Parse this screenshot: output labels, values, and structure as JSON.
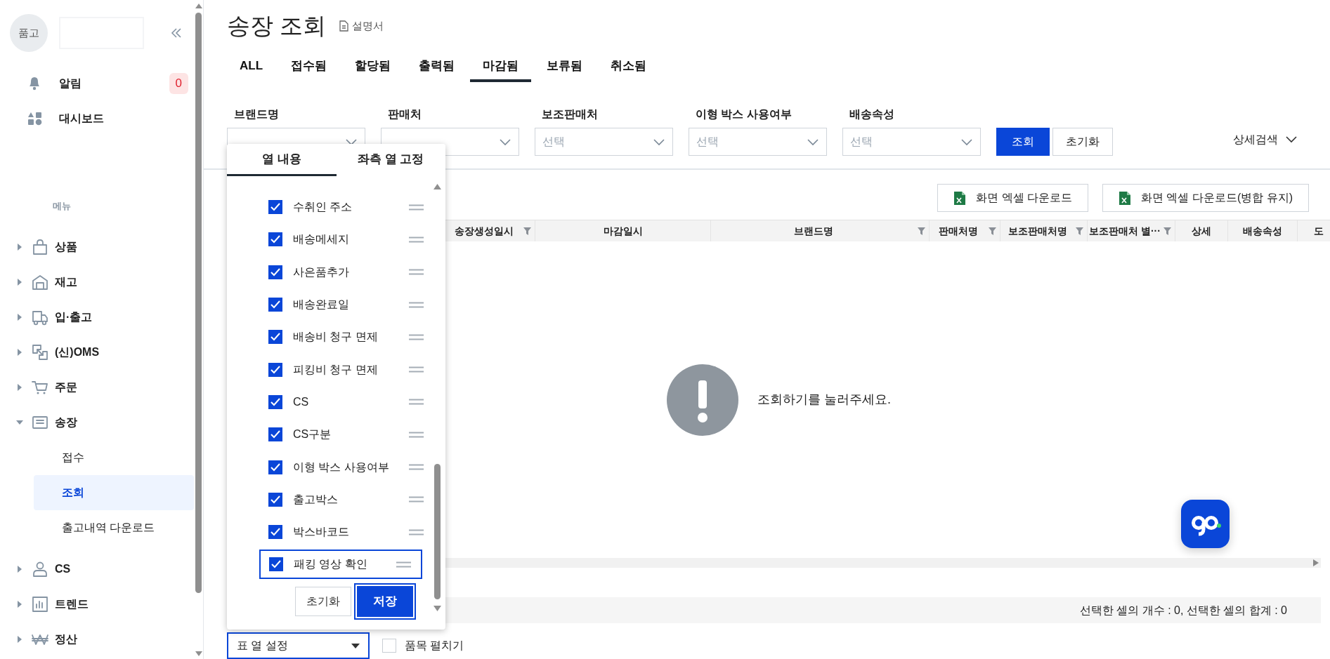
{
  "sidebar": {
    "avatar_text": "품고",
    "top_items": [
      {
        "label": "알림",
        "badge": "0"
      },
      {
        "label": "대시보드"
      }
    ],
    "menu_heading": "메뉴",
    "menu": [
      {
        "label": "상품",
        "expanded": false
      },
      {
        "label": "재고",
        "expanded": false
      },
      {
        "label": "입·출고",
        "expanded": false
      },
      {
        "label": "(신)OMS",
        "expanded": false
      },
      {
        "label": "주문",
        "expanded": false
      },
      {
        "label": "송장",
        "expanded": true,
        "children": [
          {
            "label": "접수",
            "selected": false
          },
          {
            "label": "조회",
            "selected": true
          },
          {
            "label": "출고내역 다운로드",
            "selected": false
          }
        ]
      },
      {
        "label": "CS",
        "expanded": false
      },
      {
        "label": "트렌드",
        "expanded": false
      },
      {
        "label": "정산",
        "expanded": false
      }
    ]
  },
  "page": {
    "title": "송장 조회",
    "manual_link": "설명서",
    "tabs": [
      {
        "label": "ALL",
        "selected": false
      },
      {
        "label": "접수됨",
        "selected": false
      },
      {
        "label": "할당됨",
        "selected": false
      },
      {
        "label": "출력됨",
        "selected": false
      },
      {
        "label": "마감됨",
        "selected": true
      },
      {
        "label": "보류됨",
        "selected": false
      },
      {
        "label": "취소됨",
        "selected": false
      }
    ],
    "filters": [
      {
        "label": "브랜드명"
      },
      {
        "label": "판매처"
      },
      {
        "label": "보조판매처",
        "placeholder": "선택"
      },
      {
        "label": "이형 박스 사용여부",
        "placeholder": "선택"
      },
      {
        "label": "배송속성",
        "placeholder": "선택"
      }
    ],
    "search_button": "조회",
    "reset_button": "초기화",
    "detail_search": "상세검색",
    "excel_buttons": [
      "화면 엑셀 다운로드",
      "화면 엑셀 다운로드(병합 유지)"
    ],
    "table": {
      "columns": [
        {
          "label": "송장생성일시",
          "filter": true
        },
        {
          "label": "마감일시",
          "filter": false
        },
        {
          "label": "브랜드명",
          "filter": true
        },
        {
          "label": "판매처명",
          "filter": true
        },
        {
          "label": "보조판매처명",
          "filter": true
        },
        {
          "label": "보조판매처 별···",
          "filter": true
        },
        {
          "label": "상세",
          "filter": false
        },
        {
          "label": "배송속성",
          "filter": false
        },
        {
          "label": "도",
          "filter": false
        }
      ]
    },
    "empty_message": "조회하기를 눌러주세요.",
    "status_text": "선택한 셀의 개수 : 0, 선택한 셀의 합계 : 0",
    "column_settings": {
      "label": "표 열 설정",
      "focused": true
    },
    "expand_items": {
      "label": "품목 펼치기",
      "checked": false
    }
  },
  "column_popup": {
    "tabs": [
      {
        "label": "열 내용",
        "selected": true
      },
      {
        "label": "좌측 열 고정",
        "selected": false
      }
    ],
    "items": [
      {
        "label": "수취인 주소",
        "checked": true,
        "highlighted": false
      },
      {
        "label": "배송메세지",
        "checked": true,
        "highlighted": false
      },
      {
        "label": "사은품추가",
        "checked": true,
        "highlighted": false
      },
      {
        "label": "배송완료일",
        "checked": true,
        "highlighted": false
      },
      {
        "label": "배송비 청구 면제",
        "checked": true,
        "highlighted": false
      },
      {
        "label": "피킹비 청구 면제",
        "checked": true,
        "highlighted": false
      },
      {
        "label": "CS",
        "checked": true,
        "highlighted": false
      },
      {
        "label": "CS구분",
        "checked": true,
        "highlighted": false
      },
      {
        "label": "이형 박스 사용여부",
        "checked": true,
        "highlighted": false
      },
      {
        "label": "출고박스",
        "checked": true,
        "highlighted": false
      },
      {
        "label": "박스바코드",
        "checked": true,
        "highlighted": false
      },
      {
        "label": "패킹 영상 확인",
        "checked": true,
        "highlighted": true
      }
    ],
    "reset_button": "초기화",
    "save_button": {
      "label": "저장",
      "focused": true
    }
  }
}
